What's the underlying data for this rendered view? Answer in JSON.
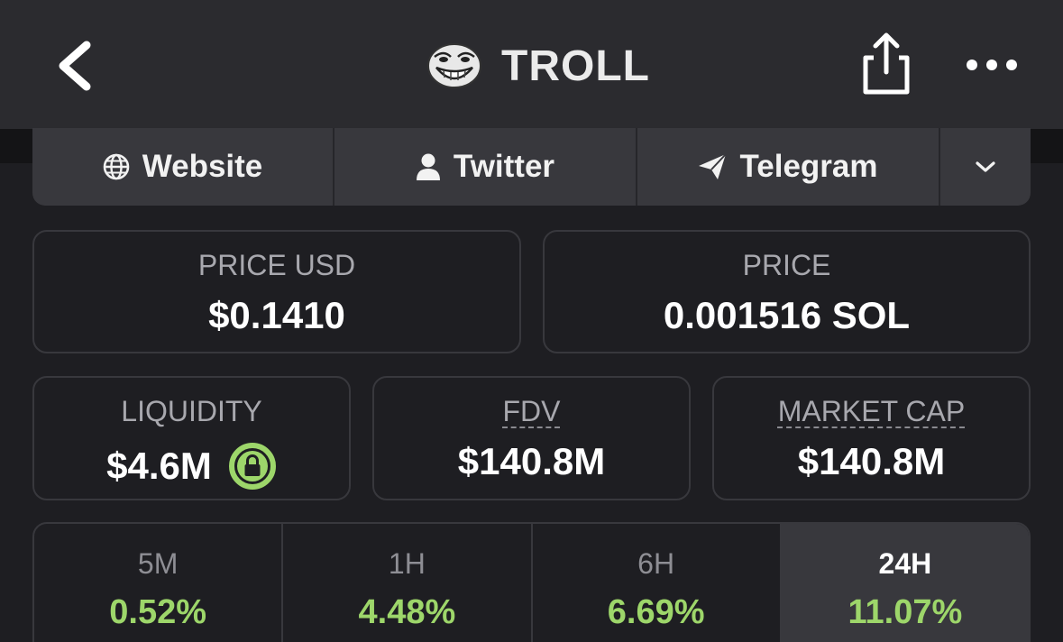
{
  "header": {
    "token_name": "TROLL",
    "icons": {
      "back": "chevron-left-icon",
      "logo": "troll-face-logo",
      "share": "share-icon",
      "more": "more-dots-icon"
    }
  },
  "links": [
    {
      "label": "Website",
      "icon": "globe-icon"
    },
    {
      "label": "Twitter",
      "icon": "user-icon"
    },
    {
      "label": "Telegram",
      "icon": "paper-plane-icon"
    }
  ],
  "stats": {
    "price_usd": {
      "label": "PRICE USD",
      "value": "$0.1410"
    },
    "price_native": {
      "label": "PRICE",
      "value": "0.001516 SOL"
    },
    "liquidity": {
      "label": "LIQUIDITY",
      "value": "$4.6M"
    },
    "fdv": {
      "label": "FDV",
      "value": "$140.8M"
    },
    "market_cap": {
      "label": "MARKET CAP",
      "value": "$140.8M"
    }
  },
  "timeframes": [
    {
      "label": "5M",
      "change": "0.52%"
    },
    {
      "label": "1H",
      "change": "4.48%"
    },
    {
      "label": "6H",
      "change": "6.69%"
    },
    {
      "label": "24H",
      "change": "11.07%",
      "active": true
    }
  ],
  "colors": {
    "positive": "#9dd66a",
    "lock_ring": "#9dd66a",
    "header_bg": "#2b2b2f",
    "page_bg": "#1e1e22"
  }
}
